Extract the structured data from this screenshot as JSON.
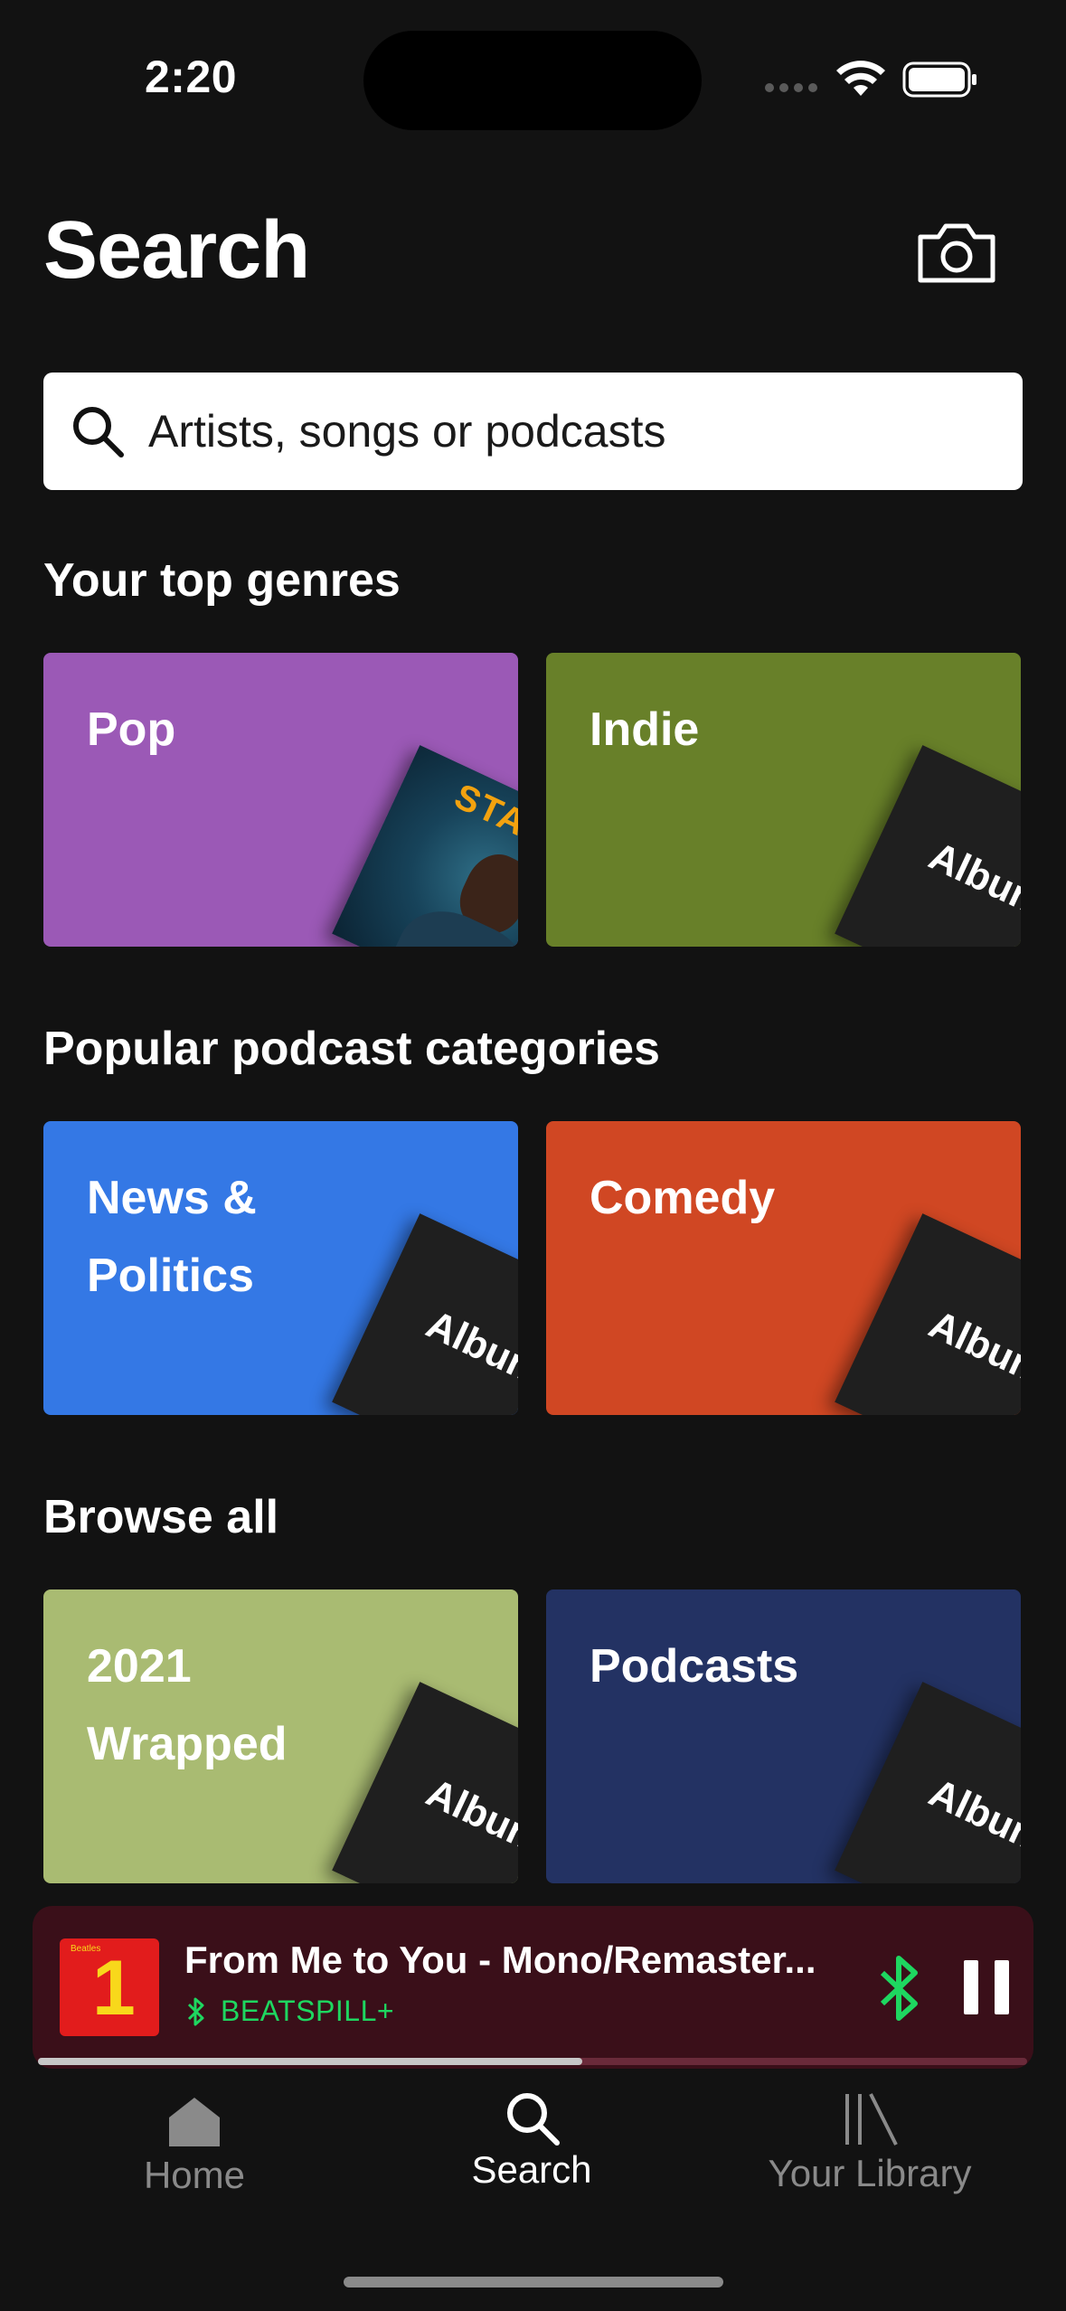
{
  "status_bar": {
    "time": "2:20"
  },
  "header": {
    "title": "Search"
  },
  "search": {
    "placeholder": "Artists, songs or podcasts"
  },
  "sections": {
    "top_genres": {
      "heading": "Your top genres",
      "cards": [
        {
          "label": "Pop",
          "color": "#9b59b6",
          "art": "The Weeknd Starboy cover",
          "art_text": "STAR"
        },
        {
          "label": "Indie",
          "color": "#688029",
          "art_text": "Album"
        }
      ]
    },
    "podcast_categories": {
      "heading": "Popular podcast categories",
      "cards": [
        {
          "label": "News & Politics",
          "color": "#3478e5",
          "art_text": "Album"
        },
        {
          "label": "Comedy",
          "color": "#d04723",
          "art_text": "Album"
        }
      ]
    },
    "browse_all": {
      "heading": "Browse all",
      "cards": [
        {
          "label": "2021 Wrapped",
          "color": "#a9bb72",
          "art_text": "Album"
        },
        {
          "label": "Podcasts",
          "color": "#233263",
          "art_text": "Album"
        }
      ]
    }
  },
  "now_playing": {
    "title": "From Me to You - Mono/Remaster...",
    "device": "BEATSPILL+",
    "cover_number": "1",
    "cover_text": "Beatles",
    "progress": 0.55,
    "bg_color": "#3a0f19",
    "device_color": "#1ed760"
  },
  "tabs": [
    {
      "label": "Home",
      "icon": "home-icon",
      "active": false
    },
    {
      "label": "Search",
      "icon": "search-icon",
      "active": true
    },
    {
      "label": "Your Library",
      "icon": "library-icon",
      "active": false
    }
  ]
}
